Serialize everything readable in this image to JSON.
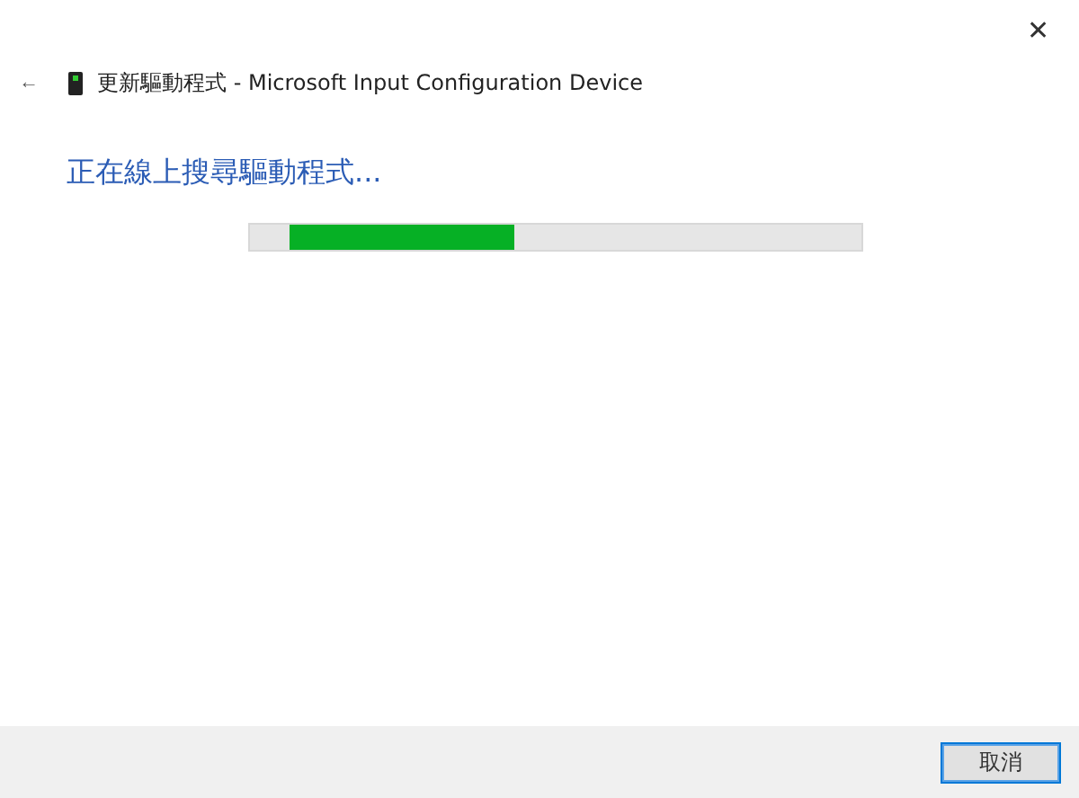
{
  "window": {
    "close_glyph": "✕"
  },
  "header": {
    "back_glyph": "←",
    "title": "更新驅動程式 - Microsoft Input Configuration Device"
  },
  "heading": "正在線上搜尋驅動程式...",
  "buttons": [
    {
      "label": "取消"
    }
  ]
}
